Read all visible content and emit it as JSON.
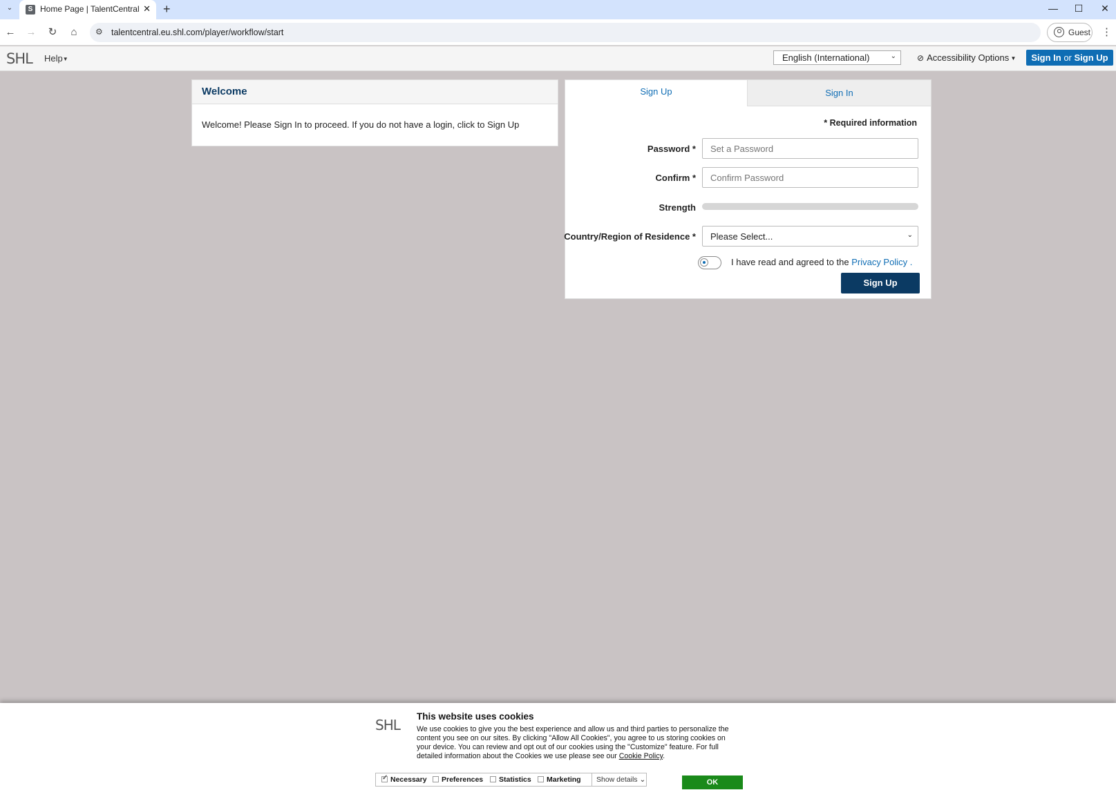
{
  "browser": {
    "tab_title": "Home Page | TalentCentral",
    "tab_favicon_letter": "S",
    "new_tab_icon": "plus-icon",
    "url": "talentcentral.eu.shl.com/player/workflow/start",
    "profile_label": "Guest",
    "window_controls": [
      "minimize-icon",
      "maximize-icon",
      "close-icon"
    ]
  },
  "header": {
    "logo": "SHL",
    "help_label": "Help",
    "language_selected": "English (International)",
    "accessibility_label": "Accessibility Options",
    "signin_label": "Sign In",
    "or_label": "or",
    "signup_label": "Sign Up"
  },
  "welcome": {
    "title": "Welcome",
    "message": "Welcome! Please Sign In to proceed. If you do not have a login, click to Sign Up"
  },
  "signup_form": {
    "tab_signup": "Sign Up",
    "tab_signin": "Sign In",
    "required_info": "* Required information",
    "password_label": "Password *",
    "password_placeholder": "Set a Password",
    "confirm_label": "Confirm *",
    "confirm_placeholder": "Confirm Password",
    "strength_label": "Strength",
    "strength_value": 0,
    "country_label": "Country/Region of Residence *",
    "country_selected": "Please Select...",
    "agree_text": "I have read and agreed to the",
    "privacy_link": "Privacy Policy",
    "agree_suffix": ".",
    "privacy_agreed": false,
    "submit_label": "Sign Up"
  },
  "cookie_banner": {
    "logo": "SHL",
    "title": "This website uses cookies",
    "body": "We use cookies to give you the best experience and allow us and third parties to personalize the content you see on our sites. By clicking \"Allow All Cookies\", you agree to us storing cookies on your device. You can review and opt out of our cookies using the \"Customize\" feature. For full detailed information about the Cookies we use please see our",
    "policy_link": "Cookie Policy",
    "policy_suffix": ".",
    "consents": [
      {
        "label": "Necessary",
        "checked": true
      },
      {
        "label": "Preferences",
        "checked": false
      },
      {
        "label": "Statistics",
        "checked": false
      },
      {
        "label": "Marketing",
        "checked": false
      }
    ],
    "show_details_label": "Show details",
    "ok_label": "OK"
  },
  "colors": {
    "page_background": "#c9c3c4",
    "brand_blue": "#0f6db4",
    "brand_navy": "#0b3a63",
    "ok_green": "#1a8a1a",
    "tabbar": "#d3e3fd"
  }
}
